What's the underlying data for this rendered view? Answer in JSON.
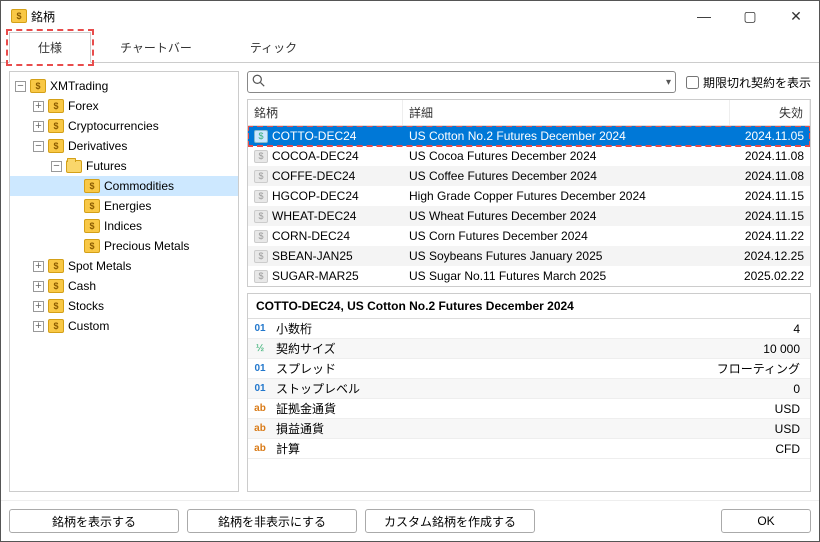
{
  "titlebar": {
    "title": "銘柄"
  },
  "tabs": [
    {
      "label": "仕様",
      "active": true
    },
    {
      "label": "チャートバー",
      "active": false
    },
    {
      "label": "ティック",
      "active": false
    }
  ],
  "tree": {
    "root": "XMTrading",
    "nodes": [
      {
        "label": "Forex",
        "level": 1,
        "expandable": true
      },
      {
        "label": "Cryptocurrencies",
        "level": 1,
        "expandable": true
      },
      {
        "label": "Derivatives",
        "level": 1,
        "expandable": true,
        "expanded": true
      },
      {
        "label": "Futures",
        "level": 2,
        "expandable": true,
        "expanded": true,
        "folder": true
      },
      {
        "label": "Commodities",
        "level": 3,
        "selected": true
      },
      {
        "label": "Energies",
        "level": 3
      },
      {
        "label": "Indices",
        "level": 3
      },
      {
        "label": "Precious Metals",
        "level": 3
      },
      {
        "label": "Spot Metals",
        "level": 1,
        "expandable": true
      },
      {
        "label": "Cash",
        "level": 1,
        "expandable": true
      },
      {
        "label": "Stocks",
        "level": 1,
        "expandable": true
      },
      {
        "label": "Custom",
        "level": 1,
        "expandable": true
      }
    ]
  },
  "search": {
    "placeholder": "",
    "checkbox_label": "期限切れ契約を表示"
  },
  "grid": {
    "headers": {
      "symbol": "銘柄",
      "desc": "詳細",
      "expiry": "失効"
    },
    "rows": [
      {
        "symbol": "COTTO-DEC24",
        "desc": "US Cotton No.2 Futures December 2024",
        "expiry": "2024.11.05",
        "selected": true
      },
      {
        "symbol": "COCOA-DEC24",
        "desc": "US Cocoa Futures December 2024",
        "expiry": "2024.11.08"
      },
      {
        "symbol": "COFFE-DEC24",
        "desc": "US Coffee Futures December 2024",
        "expiry": "2024.11.08"
      },
      {
        "symbol": "HGCOP-DEC24",
        "desc": "High Grade Copper Futures December 2024",
        "expiry": "2024.11.15"
      },
      {
        "symbol": "WHEAT-DEC24",
        "desc": "US Wheat Futures December 2024",
        "expiry": "2024.11.15"
      },
      {
        "symbol": "CORN-DEC24",
        "desc": "US Corn Futures December 2024",
        "expiry": "2024.11.22"
      },
      {
        "symbol": "SBEAN-JAN25",
        "desc": "US Soybeans Futures January 2025",
        "expiry": "2024.12.25"
      },
      {
        "symbol": "SUGAR-MAR25",
        "desc": "US Sugar No.11 Futures March 2025",
        "expiry": "2025.02.22"
      }
    ]
  },
  "details": {
    "title": "COTTO-DEC24, US Cotton No.2 Futures December 2024",
    "rows": [
      {
        "badge": "01",
        "badgec": "blue",
        "name": "小数桁",
        "value": "4"
      },
      {
        "badge": "½",
        "badgec": "",
        "name": "契約サイズ",
        "value": "10 000"
      },
      {
        "badge": "01",
        "badgec": "blue",
        "name": "スプレッド",
        "value": "フローティング"
      },
      {
        "badge": "01",
        "badgec": "blue",
        "name": "ストップレベル",
        "value": "0"
      },
      {
        "badge": "ab",
        "badgec": "orange",
        "name": "証拠金通貨",
        "value": "USD"
      },
      {
        "badge": "ab",
        "badgec": "orange",
        "name": "損益通貨",
        "value": "USD"
      },
      {
        "badge": "ab",
        "badgec": "orange",
        "name": "計算",
        "value": "CFD"
      }
    ]
  },
  "footer": {
    "show": "銘柄を表示する",
    "hide": "銘柄を非表示にする",
    "custom": "カスタム銘柄を作成する",
    "ok": "OK"
  }
}
